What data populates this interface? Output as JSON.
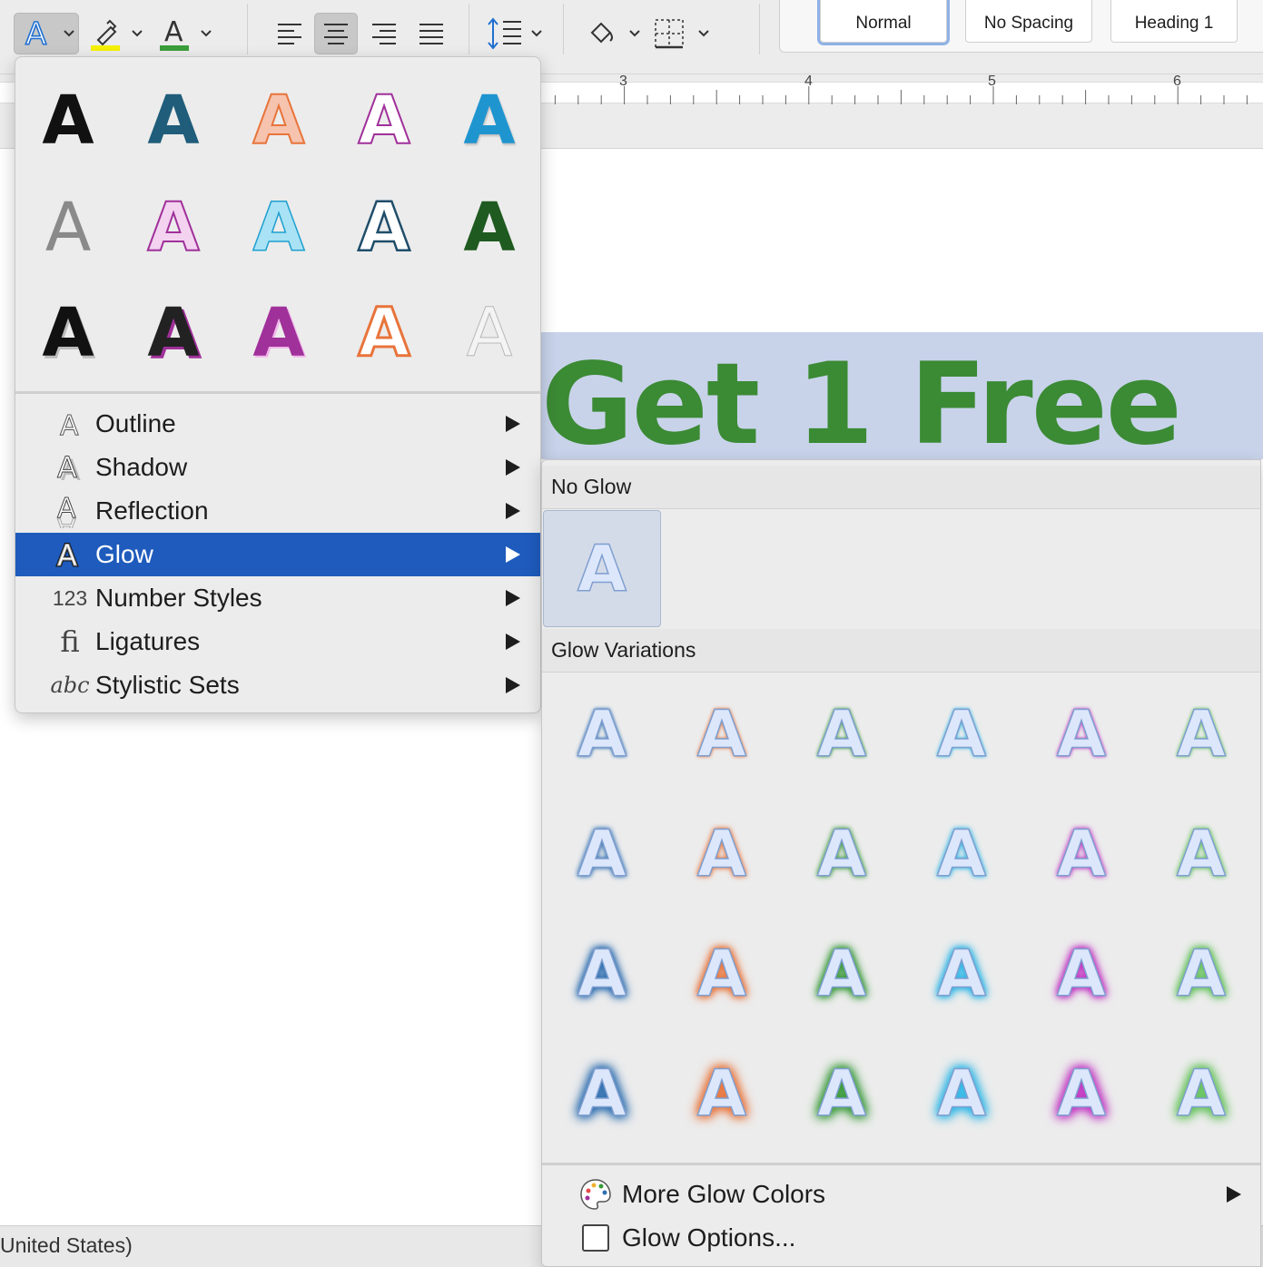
{
  "toolbar": {
    "text_effects_icon": "text-effects-icon",
    "highlight_color": "#f5f000",
    "font_color": "#3a9e3a",
    "align_left_icon": "align-left-icon",
    "align_center_icon": "align-center-icon",
    "align_right_icon": "align-right-icon",
    "justify_icon": "justify-icon",
    "line_spacing_icon": "line-spacing-icon",
    "shading_icon": "shading-icon",
    "borders_icon": "borders-icon"
  },
  "styles": {
    "items": [
      {
        "label": "Normal",
        "selected": true
      },
      {
        "label": "No Spacing",
        "selected": false
      },
      {
        "label": "Heading 1",
        "selected": false
      }
    ]
  },
  "ruler": {
    "numbers": [
      "3",
      "4",
      "5",
      "6"
    ]
  },
  "document": {
    "headline": "Get 1 Free",
    "headline_color": "#3b8a34",
    "highlight_color": "#c8d3ea"
  },
  "statusbar": {
    "language": "United States)"
  },
  "text_effects_menu": {
    "presets_glyph": "A",
    "items": [
      {
        "label": "Outline",
        "icon": "outline-icon",
        "active": false
      },
      {
        "label": "Shadow",
        "icon": "shadow-icon",
        "active": false
      },
      {
        "label": "Reflection",
        "icon": "reflection-icon",
        "active": false
      },
      {
        "label": "Glow",
        "icon": "glow-icon",
        "active": true
      },
      {
        "label": "Number Styles",
        "icon": "number-styles-icon",
        "icon_text": "123",
        "active": false
      },
      {
        "label": "Ligatures",
        "icon": "ligatures-icon",
        "icon_text": "fi",
        "active": false
      },
      {
        "label": "Stylistic Sets",
        "icon": "stylistic-sets-icon",
        "icon_text": "abc",
        "active": false
      }
    ],
    "accent_color": "#1e5bbc"
  },
  "glow_menu": {
    "no_glow_header": "No Glow",
    "variations_header": "Glow Variations",
    "glyph": "A",
    "glow_colors": [
      "#2f6fb0",
      "#e8743b",
      "#3a9a3a",
      "#2fb7e6",
      "#c236c2",
      "#64c25a"
    ],
    "more_colors": "More Glow Colors",
    "options": "Glow Options..."
  }
}
